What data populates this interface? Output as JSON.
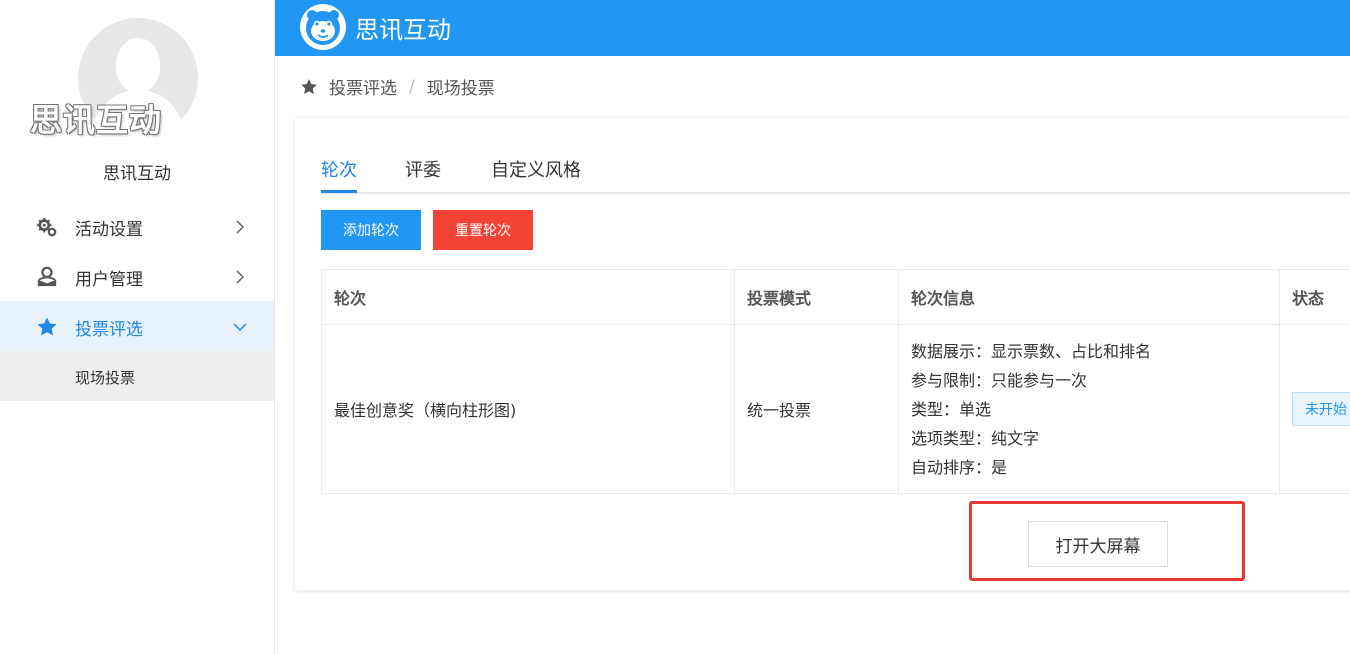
{
  "sidebar": {
    "avatar_overlay_text": "思讯互动",
    "brand_name": "思讯互动",
    "menu": [
      {
        "label": "活动设置",
        "icon": "gear-icon"
      },
      {
        "label": "用户管理",
        "icon": "user-manage-icon"
      },
      {
        "label": "投票评选",
        "icon": "star-icon",
        "active": true
      }
    ],
    "submenu": [
      {
        "label": "现场投票"
      }
    ]
  },
  "header": {
    "title": "思讯互动",
    "brand_color": "#2196f3"
  },
  "breadcrumb": {
    "parent": "投票评选",
    "separator": "/",
    "current": "现场投票"
  },
  "tabs": [
    {
      "label": "轮次",
      "active": true
    },
    {
      "label": "评委"
    },
    {
      "label": "自定义风格"
    }
  ],
  "buttons": {
    "add_round": "添加轮次",
    "reset_round": "重置轮次",
    "open_big_screen": "打开大屏幕"
  },
  "table": {
    "headers": [
      "轮次",
      "投票模式",
      "轮次信息",
      "状态"
    ],
    "rows": [
      {
        "round": "最佳创意奖（横向柱形图)",
        "mode": "统一投票",
        "info": [
          "数据展示：显示票数、占比和排名",
          "参与限制：只能参与一次",
          "类型：单选",
          "选项类型：纯文字",
          "自动排序：是"
        ],
        "status": "未开始"
      }
    ]
  },
  "colors": {
    "primary": "#2196f3",
    "danger": "#f44336",
    "highlight": "#e53935"
  }
}
